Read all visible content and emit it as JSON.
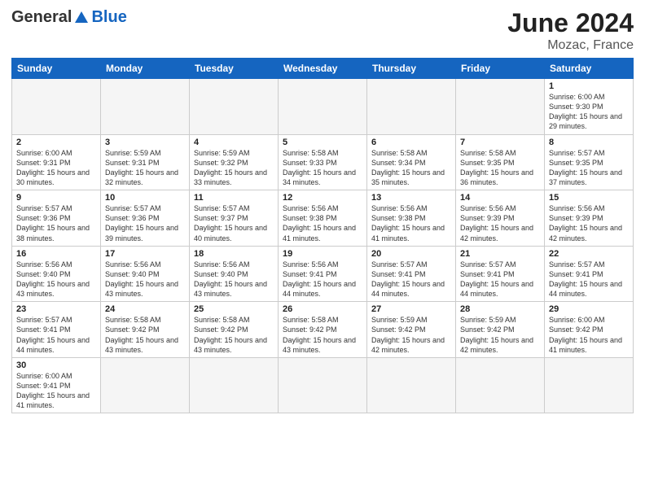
{
  "header": {
    "logo_general": "General",
    "logo_blue": "Blue",
    "month_title": "June 2024",
    "location": "Mozac, France"
  },
  "weekdays": [
    "Sunday",
    "Monday",
    "Tuesday",
    "Wednesday",
    "Thursday",
    "Friday",
    "Saturday"
  ],
  "days": [
    {
      "num": "",
      "info": ""
    },
    {
      "num": "",
      "info": ""
    },
    {
      "num": "",
      "info": ""
    },
    {
      "num": "",
      "info": ""
    },
    {
      "num": "",
      "info": ""
    },
    {
      "num": "",
      "info": ""
    },
    {
      "num": "1",
      "info": "Sunrise: 6:00 AM\nSunset: 9:30 PM\nDaylight: 15 hours\nand 29 minutes."
    },
    {
      "num": "2",
      "info": "Sunrise: 6:00 AM\nSunset: 9:31 PM\nDaylight: 15 hours\nand 30 minutes."
    },
    {
      "num": "3",
      "info": "Sunrise: 5:59 AM\nSunset: 9:31 PM\nDaylight: 15 hours\nand 32 minutes."
    },
    {
      "num": "4",
      "info": "Sunrise: 5:59 AM\nSunset: 9:32 PM\nDaylight: 15 hours\nand 33 minutes."
    },
    {
      "num": "5",
      "info": "Sunrise: 5:58 AM\nSunset: 9:33 PM\nDaylight: 15 hours\nand 34 minutes."
    },
    {
      "num": "6",
      "info": "Sunrise: 5:58 AM\nSunset: 9:34 PM\nDaylight: 15 hours\nand 35 minutes."
    },
    {
      "num": "7",
      "info": "Sunrise: 5:58 AM\nSunset: 9:35 PM\nDaylight: 15 hours\nand 36 minutes."
    },
    {
      "num": "8",
      "info": "Sunrise: 5:57 AM\nSunset: 9:35 PM\nDaylight: 15 hours\nand 37 minutes."
    },
    {
      "num": "9",
      "info": "Sunrise: 5:57 AM\nSunset: 9:36 PM\nDaylight: 15 hours\nand 38 minutes."
    },
    {
      "num": "10",
      "info": "Sunrise: 5:57 AM\nSunset: 9:36 PM\nDaylight: 15 hours\nand 39 minutes."
    },
    {
      "num": "11",
      "info": "Sunrise: 5:57 AM\nSunset: 9:37 PM\nDaylight: 15 hours\nand 40 minutes."
    },
    {
      "num": "12",
      "info": "Sunrise: 5:56 AM\nSunset: 9:38 PM\nDaylight: 15 hours\nand 41 minutes."
    },
    {
      "num": "13",
      "info": "Sunrise: 5:56 AM\nSunset: 9:38 PM\nDaylight: 15 hours\nand 41 minutes."
    },
    {
      "num": "14",
      "info": "Sunrise: 5:56 AM\nSunset: 9:39 PM\nDaylight: 15 hours\nand 42 minutes."
    },
    {
      "num": "15",
      "info": "Sunrise: 5:56 AM\nSunset: 9:39 PM\nDaylight: 15 hours\nand 42 minutes."
    },
    {
      "num": "16",
      "info": "Sunrise: 5:56 AM\nSunset: 9:40 PM\nDaylight: 15 hours\nand 43 minutes."
    },
    {
      "num": "17",
      "info": "Sunrise: 5:56 AM\nSunset: 9:40 PM\nDaylight: 15 hours\nand 43 minutes."
    },
    {
      "num": "18",
      "info": "Sunrise: 5:56 AM\nSunset: 9:40 PM\nDaylight: 15 hours\nand 43 minutes."
    },
    {
      "num": "19",
      "info": "Sunrise: 5:56 AM\nSunset: 9:41 PM\nDaylight: 15 hours\nand 44 minutes."
    },
    {
      "num": "20",
      "info": "Sunrise: 5:57 AM\nSunset: 9:41 PM\nDaylight: 15 hours\nand 44 minutes."
    },
    {
      "num": "21",
      "info": "Sunrise: 5:57 AM\nSunset: 9:41 PM\nDaylight: 15 hours\nand 44 minutes."
    },
    {
      "num": "22",
      "info": "Sunrise: 5:57 AM\nSunset: 9:41 PM\nDaylight: 15 hours\nand 44 minutes."
    },
    {
      "num": "23",
      "info": "Sunrise: 5:57 AM\nSunset: 9:41 PM\nDaylight: 15 hours\nand 44 minutes."
    },
    {
      "num": "24",
      "info": "Sunrise: 5:58 AM\nSunset: 9:42 PM\nDaylight: 15 hours\nand 43 minutes."
    },
    {
      "num": "25",
      "info": "Sunrise: 5:58 AM\nSunset: 9:42 PM\nDaylight: 15 hours\nand 43 minutes."
    },
    {
      "num": "26",
      "info": "Sunrise: 5:58 AM\nSunset: 9:42 PM\nDaylight: 15 hours\nand 43 minutes."
    },
    {
      "num": "27",
      "info": "Sunrise: 5:59 AM\nSunset: 9:42 PM\nDaylight: 15 hours\nand 42 minutes."
    },
    {
      "num": "28",
      "info": "Sunrise: 5:59 AM\nSunset: 9:42 PM\nDaylight: 15 hours\nand 42 minutes."
    },
    {
      "num": "29",
      "info": "Sunrise: 6:00 AM\nSunset: 9:42 PM\nDaylight: 15 hours\nand 41 minutes."
    },
    {
      "num": "30",
      "info": "Sunrise: 6:00 AM\nSunset: 9:41 PM\nDaylight: 15 hours\nand 41 minutes."
    }
  ]
}
